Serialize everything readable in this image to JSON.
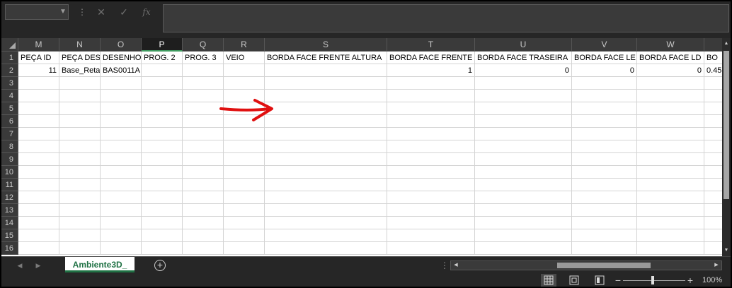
{
  "namebox": {
    "value": ""
  },
  "formula_bar": {
    "value": "",
    "cancel_icon": "close-icon",
    "enter_icon": "check-icon",
    "function_label": "fx"
  },
  "columns": [
    {
      "letter": "M",
      "header": "PEÇA ID"
    },
    {
      "letter": "N",
      "header": "PEÇA DESC"
    },
    {
      "letter": "O",
      "header": "DESENHO"
    },
    {
      "letter": "P",
      "header": "PROG. 2"
    },
    {
      "letter": "Q",
      "header": "PROG. 3"
    },
    {
      "letter": "R",
      "header": "VEIO"
    },
    {
      "letter": "S",
      "header": "BORDA FACE FRENTE ALTURA"
    },
    {
      "letter": "T",
      "header": "BORDA FACE FRENTE"
    },
    {
      "letter": "U",
      "header": "BORDA FACE TRASEIRA"
    },
    {
      "letter": "V",
      "header": "BORDA FACE LE"
    },
    {
      "letter": "W",
      "header": "BORDA FACE LD"
    },
    {
      "letter": "",
      "header": "BO"
    }
  ],
  "selected_column": "P",
  "row_numbers": [
    "1",
    "2",
    "3",
    "4",
    "5",
    "6",
    "7",
    "8",
    "9",
    "10",
    "11",
    "12",
    "13",
    "14",
    "15",
    "16"
  ],
  "row2": [
    "11",
    "Base_Reta",
    "BAS0011A",
    "",
    "",
    "",
    "",
    "1",
    "0",
    "0",
    "0",
    "0.45"
  ],
  "sheet_tab": {
    "label": "Ambiente3D_"
  },
  "status": {
    "zoom": "100%"
  },
  "accent": {
    "green": "#207245",
    "arrow_red": "#e01010"
  }
}
